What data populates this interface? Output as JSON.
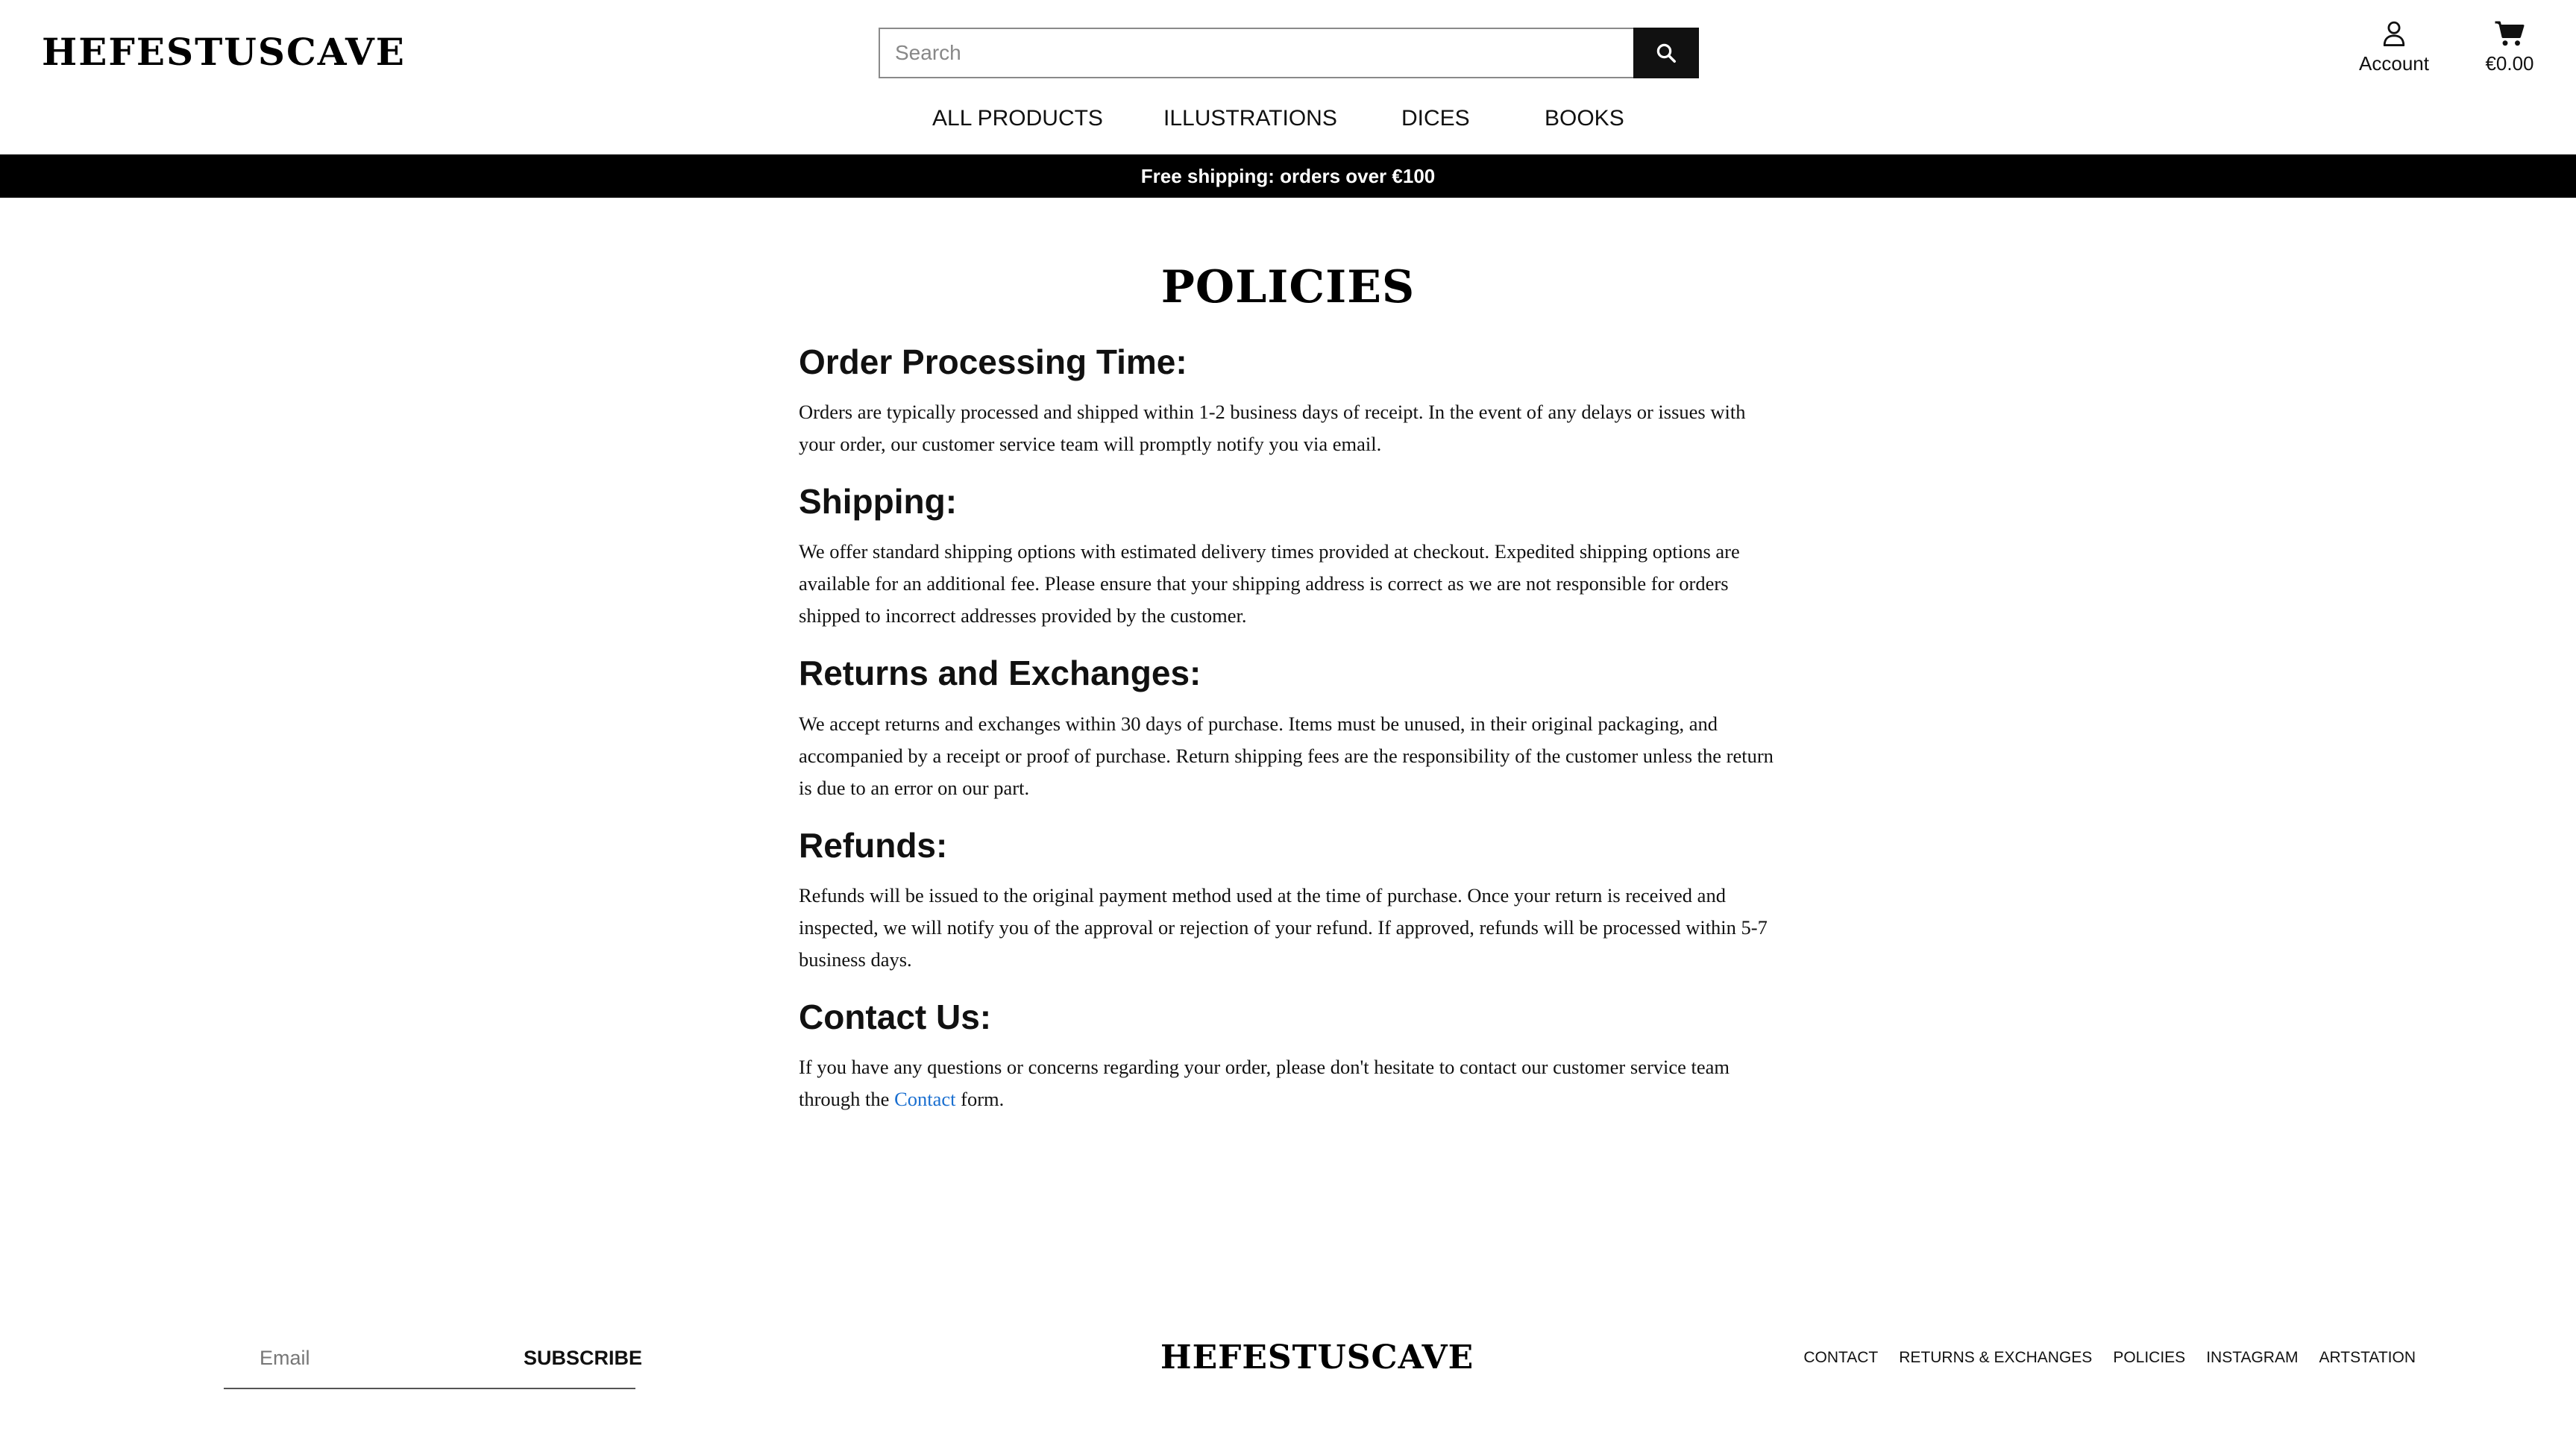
{
  "header": {
    "logo_text": "HEFESTUSCAVE",
    "search": {
      "placeholder": "Search",
      "value": ""
    },
    "account_label": "Account",
    "cart_total": "€0.00"
  },
  "nav": {
    "items": [
      {
        "label": "ALL PRODUCTS"
      },
      {
        "label": "ILLUSTRATIONS"
      },
      {
        "label": "DICES"
      },
      {
        "label": "BOOKS"
      }
    ]
  },
  "banner": {
    "text": "Free shipping: orders over €100"
  },
  "page": {
    "title": "POLICIES",
    "sections": [
      {
        "heading": "Order Processing Time:",
        "body": "Orders are typically processed and shipped within 1-2 business days of receipt. In the event of any delays or issues with your order, our customer service team will promptly notify you via email."
      },
      {
        "heading": "Shipping:",
        "body": "We offer standard shipping options with estimated delivery times provided at checkout. Expedited shipping options are available for an additional fee. Please ensure that your shipping address is correct as we are not responsible for orders shipped to incorrect addresses provided by the customer."
      },
      {
        "heading": "Returns and Exchanges:",
        "body": "We accept returns and exchanges within 30 days of purchase. Items must be unused, in their original packaging, and accompanied by a receipt or proof of purchase. Return shipping fees are the responsibility of the customer unless the return is due to an error on our part."
      },
      {
        "heading": "Refunds:",
        "body": "Refunds will be issued to the original payment method used at the time of purchase. Once your return is received and inspected, we will notify you of the approval or rejection of your refund. If approved, refunds will be processed within 5-7 business days."
      },
      {
        "heading": "Contact Us:",
        "body_before": "If you have any questions or concerns regarding your order, please don't hesitate to contact our customer service team through the",
        "link_text": "Contact",
        "body_after": "form."
      }
    ]
  },
  "footer": {
    "email_placeholder": "Email",
    "subscribe_label": "SUBSCRIBE",
    "logo_text": "HEFESTUSCAVE",
    "links": [
      "CONTACT",
      "RETURNS & EXCHANGES",
      "POLICIES",
      "INSTAGRAM",
      "ARTSTATION"
    ]
  },
  "colors": {
    "banner_bg": "#000000",
    "link": "#1a6fd0",
    "search_button_bg": "#111111"
  }
}
